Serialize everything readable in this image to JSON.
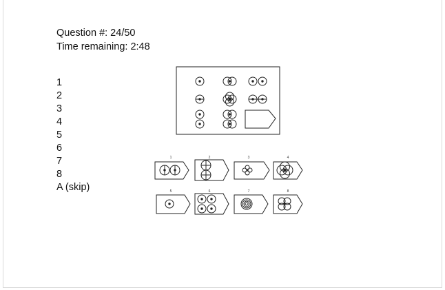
{
  "header": {
    "question": "Question #: 24/50",
    "time": "Time remaining: 2:48"
  },
  "options": [
    {
      "label": "1"
    },
    {
      "label": "2"
    },
    {
      "label": "3"
    },
    {
      "label": "4"
    },
    {
      "label": "5"
    },
    {
      "label": "6"
    },
    {
      "label": "7"
    },
    {
      "label": "8"
    },
    {
      "label": "A (skip)"
    }
  ],
  "matrix": {
    "cells": [
      "single-circle",
      "two-overlap-horizontal",
      "two-separate",
      "single-circle-rotated",
      "four-overlap-cross",
      "two-pair-rotated",
      "two-vertical",
      "two-vertical-overlap",
      "missing"
    ]
  },
  "answers": [
    {
      "number": "1",
      "figure": "two-circles-side-by-side-crossed"
    },
    {
      "number": "2",
      "figure": "two-circles-stacked-crossed"
    },
    {
      "number": "3",
      "figure": "flower-small"
    },
    {
      "number": "4",
      "figure": "four-overlap-cross"
    },
    {
      "number": "5",
      "figure": "single-circle-dot"
    },
    {
      "number": "6",
      "figure": "four-circles-grid"
    },
    {
      "number": "7",
      "figure": "concentric-circles"
    },
    {
      "number": "8",
      "figure": "four-overlap-small"
    }
  ]
}
